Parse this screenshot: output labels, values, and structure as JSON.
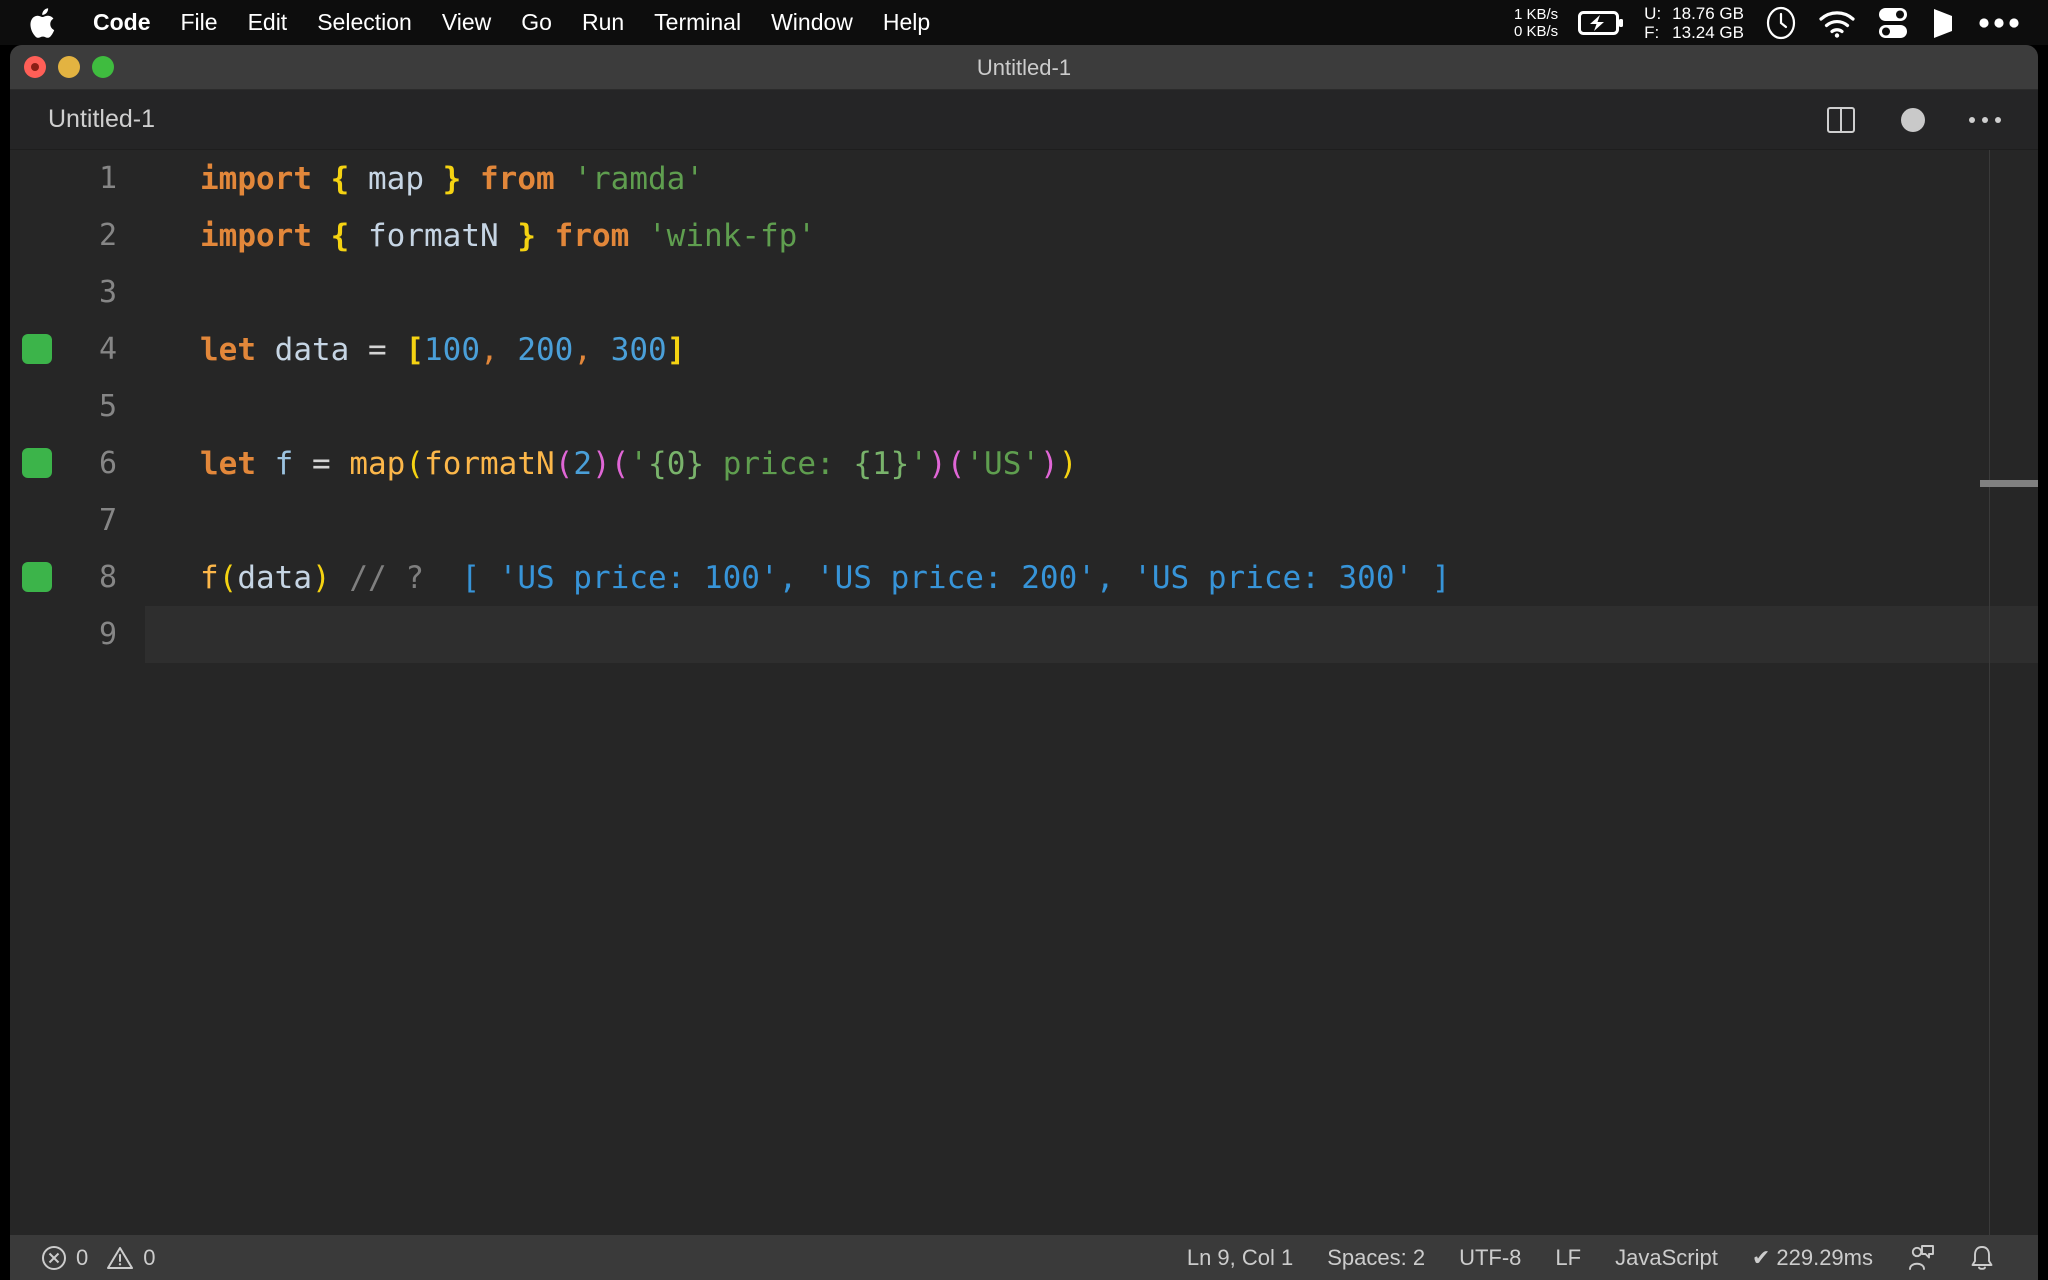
{
  "menubar": {
    "apple_icon": "apple-logo-icon",
    "items": [
      {
        "label": "Code",
        "bold": true
      },
      {
        "label": "File",
        "bold": false
      },
      {
        "label": "Edit",
        "bold": false
      },
      {
        "label": "Selection",
        "bold": false
      },
      {
        "label": "View",
        "bold": false
      },
      {
        "label": "Go",
        "bold": false
      },
      {
        "label": "Run",
        "bold": false
      },
      {
        "label": "Terminal",
        "bold": false
      },
      {
        "label": "Window",
        "bold": false
      },
      {
        "label": "Help",
        "bold": false
      }
    ],
    "status": {
      "net_up": "1 KB/s",
      "net_down": "0 KB/s",
      "battery_icon": "battery-charging-icon",
      "disk_used_key": "U:",
      "disk_used_value": "18.76 GB",
      "disk_free_key": "F:",
      "disk_free_value": "13.24 GB",
      "clock_icon": "clock-icon",
      "wifi_icon": "wifi-icon",
      "toggles_icon": "control-center-icon",
      "flag_icon": "flag-icon",
      "more_icon": "ellipsis-icon"
    }
  },
  "window": {
    "title": "Untitled-1",
    "traffic_lights": [
      "close-button",
      "minimize-button",
      "maximize-button"
    ]
  },
  "tabstrip": {
    "tab_label": "Untitled-1",
    "actions": [
      "split-editor-icon",
      "unsaved-dot-icon",
      "more-actions-icon"
    ]
  },
  "editor": {
    "lines": [
      {
        "num": "1",
        "marker": false,
        "active": false,
        "tokens": [
          {
            "t": "import",
            "c": "t-kw"
          },
          {
            "t": " ",
            "c": "t-op"
          },
          {
            "t": "{",
            "c": "t-brace"
          },
          {
            "t": " ",
            "c": "t-op"
          },
          {
            "t": "map",
            "c": "t-var"
          },
          {
            "t": " ",
            "c": "t-op"
          },
          {
            "t": "}",
            "c": "t-brace"
          },
          {
            "t": " ",
            "c": "t-op"
          },
          {
            "t": "from",
            "c": "t-kw"
          },
          {
            "t": " ",
            "c": "t-op"
          },
          {
            "t": "'ramda'",
            "c": "t-str"
          }
        ]
      },
      {
        "num": "2",
        "marker": false,
        "active": false,
        "tokens": [
          {
            "t": "import",
            "c": "t-kw"
          },
          {
            "t": " ",
            "c": "t-op"
          },
          {
            "t": "{",
            "c": "t-brace"
          },
          {
            "t": " ",
            "c": "t-op"
          },
          {
            "t": "formatN",
            "c": "t-var"
          },
          {
            "t": " ",
            "c": "t-op"
          },
          {
            "t": "}",
            "c": "t-brace"
          },
          {
            "t": " ",
            "c": "t-op"
          },
          {
            "t": "from",
            "c": "t-kw"
          },
          {
            "t": " ",
            "c": "t-op"
          },
          {
            "t": "'wink-fp'",
            "c": "t-str"
          }
        ]
      },
      {
        "num": "3",
        "marker": false,
        "active": false,
        "tokens": []
      },
      {
        "num": "4",
        "marker": true,
        "active": false,
        "tokens": [
          {
            "t": "let",
            "c": "t-kw"
          },
          {
            "t": " ",
            "c": "t-op"
          },
          {
            "t": "data",
            "c": "t-var"
          },
          {
            "t": " ",
            "c": "t-op"
          },
          {
            "t": "=",
            "c": "t-op"
          },
          {
            "t": " ",
            "c": "t-op"
          },
          {
            "t": "[",
            "c": "t-brace"
          },
          {
            "t": "100",
            "c": "t-num"
          },
          {
            "t": ",",
            "c": "t-comma"
          },
          {
            "t": " ",
            "c": "t-op"
          },
          {
            "t": "200",
            "c": "t-num"
          },
          {
            "t": ",",
            "c": "t-comma"
          },
          {
            "t": " ",
            "c": "t-op"
          },
          {
            "t": "300",
            "c": "t-num"
          },
          {
            "t": "]",
            "c": "t-brace"
          }
        ]
      },
      {
        "num": "5",
        "marker": false,
        "active": false,
        "tokens": []
      },
      {
        "num": "6",
        "marker": true,
        "active": false,
        "tokens": [
          {
            "t": "let",
            "c": "t-kw"
          },
          {
            "t": " ",
            "c": "t-op"
          },
          {
            "t": "f",
            "c": "t-var2"
          },
          {
            "t": " ",
            "c": "t-op"
          },
          {
            "t": "=",
            "c": "t-op"
          },
          {
            "t": " ",
            "c": "t-op"
          },
          {
            "t": "map",
            "c": "t-fn"
          },
          {
            "t": "(",
            "c": "t-paren-y"
          },
          {
            "t": "formatN",
            "c": "t-fn"
          },
          {
            "t": "(",
            "c": "t-paren-m"
          },
          {
            "t": "2",
            "c": "t-num"
          },
          {
            "t": ")",
            "c": "t-paren-m"
          },
          {
            "t": "(",
            "c": "t-paren-m"
          },
          {
            "t": "'",
            "c": "t-str"
          },
          {
            "t": "{0}",
            "c": "t-str-lt"
          },
          {
            "t": " price: ",
            "c": "t-str"
          },
          {
            "t": "{1}",
            "c": "t-str-lt"
          },
          {
            "t": "'",
            "c": "t-str"
          },
          {
            "t": ")",
            "c": "t-paren-m"
          },
          {
            "t": "(",
            "c": "t-paren-m"
          },
          {
            "t": "'US'",
            "c": "t-str"
          },
          {
            "t": ")",
            "c": "t-paren-m"
          },
          {
            "t": ")",
            "c": "t-paren-y"
          }
        ]
      },
      {
        "num": "7",
        "marker": false,
        "active": false,
        "tokens": []
      },
      {
        "num": "8",
        "marker": true,
        "active": false,
        "tokens": [
          {
            "t": "f",
            "c": "t-fn"
          },
          {
            "t": "(",
            "c": "t-paren-y"
          },
          {
            "t": "data",
            "c": "t-var"
          },
          {
            "t": ")",
            "c": "t-paren-y"
          },
          {
            "t": " ",
            "c": "t-op"
          },
          {
            "t": "// ?",
            "c": "t-comment"
          },
          {
            "t": "  ",
            "c": "t-op"
          },
          {
            "t": "[ 'US price: 100', 'US price: 200', 'US price: 300' ]",
            "c": "t-result"
          }
        ]
      },
      {
        "num": "9",
        "marker": false,
        "active": true,
        "tokens": []
      }
    ]
  },
  "statusbar": {
    "error_icon": "error-circle-icon",
    "error_count": "0",
    "warning_icon": "warning-triangle-icon",
    "warning_count": "0",
    "cursor_position": "Ln 9, Col 1",
    "indentation": "Spaces: 2",
    "encoding": "UTF-8",
    "eol": "LF",
    "language": "JavaScript",
    "quokka_status": "✔ 229.29ms",
    "feedback_icon": "feedback-person-icon",
    "bell_icon": "bell-icon"
  },
  "colors": {
    "menubar_bg": "#0d0d0d",
    "titlebar_bg": "#3c3c3c",
    "tabstrip_bg": "#252526",
    "editor_bg": "#262626",
    "statusbar_bg": "#3a3a3a",
    "quokka_green": "#3cb44a",
    "keyword_orange": "#e2873a",
    "string_green": "#5f9e4f",
    "number_blue": "#4a9fd8",
    "function_yellow": "#fcb74a",
    "paren_magenta": "#e066d6",
    "brace_yellow": "#f5d312",
    "result_blue": "#3794d8",
    "comment_gray": "#7f7f7f"
  }
}
